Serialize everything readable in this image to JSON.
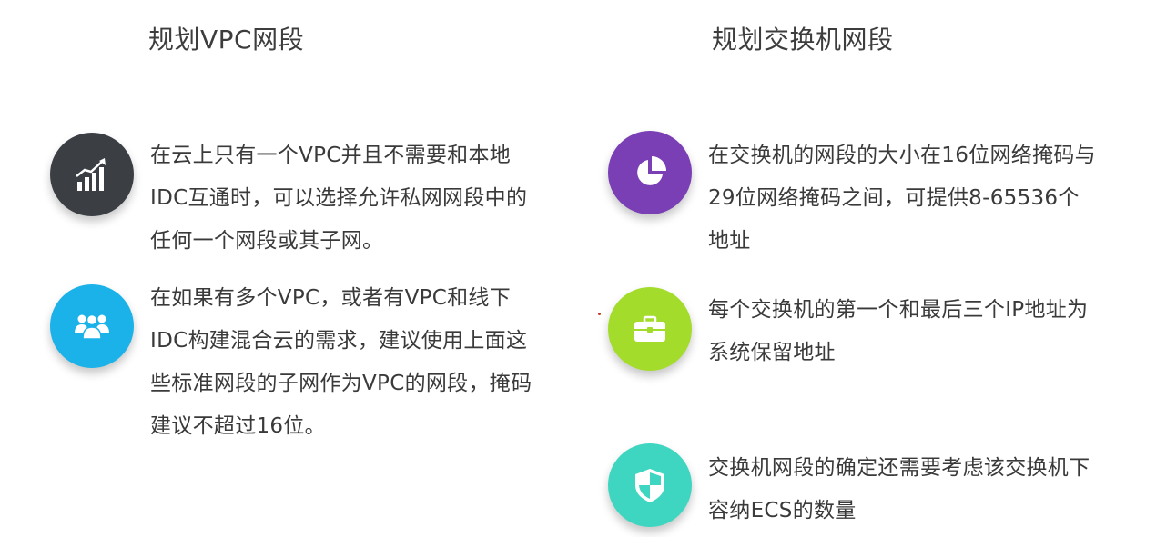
{
  "left": {
    "title": "规划VPC网段",
    "items": [
      {
        "icon": "bar-chart-icon",
        "color": "#3b3f44",
        "text": "在云上只有一个VPC并且不需要和本地IDC互通时，可以选择允许私网网段中的任何一个网段或其子网。"
      },
      {
        "icon": "team-icon",
        "color": "#1ab2e8",
        "text": "在如果有多个VPC，或者有VPC和线下IDC构建混合云的需求，建议使用上面这些标准网段的子网作为VPC的网段，掩码建议不超过16位。"
      }
    ]
  },
  "right": {
    "title": "规划交换机网段",
    "items": [
      {
        "icon": "pie-chart-icon",
        "color": "#7a3fb4",
        "text": "在交换机的网段的大小在16位网络掩码与29位网络掩码之间，可提供8-65536个地址"
      },
      {
        "icon": "toolbox-icon",
        "color": "#a4dc2c",
        "text": "每个交换机的第一个和最后三个IP地址为系统保留地址"
      },
      {
        "icon": "shield-icon",
        "color": "#3fd6c1",
        "text": "交换机网段的确定还需要考虑该交换机下容纳ECS的数量"
      }
    ]
  }
}
